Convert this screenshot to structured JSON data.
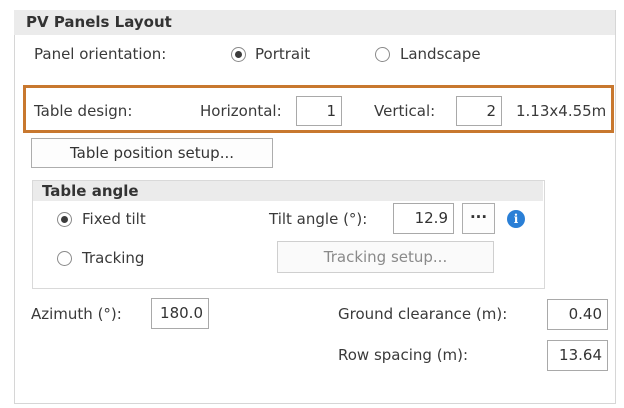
{
  "panel": {
    "title": "PV Panels Layout",
    "orientation": {
      "label": "Panel orientation:",
      "options": [
        "Portrait",
        "Landscape"
      ],
      "selected": "Portrait"
    },
    "table_design": {
      "label": "Table design:",
      "horizontal_label": "Horizontal:",
      "horizontal_value": "1",
      "vertical_label": "Vertical:",
      "vertical_value": "2",
      "dimensions": "1.13x4.55m"
    },
    "table_position_button": "Table position setup...",
    "table_angle": {
      "title": "Table angle",
      "fixed_tilt_label": "Fixed tilt",
      "tracking_label": "Tracking",
      "selected": "Fixed tilt",
      "tilt_label": "Tilt angle (°):",
      "tilt_value": "12.9",
      "more_button": "···",
      "info_icon": "i",
      "tracking_button": "Tracking setup..."
    },
    "azimuth": {
      "label": "Azimuth (°):",
      "value": "180.0"
    },
    "ground_clearance": {
      "label": "Ground clearance (m):",
      "value": "0.40"
    },
    "row_spacing": {
      "label": "Row spacing (m):",
      "value": "13.64"
    }
  }
}
